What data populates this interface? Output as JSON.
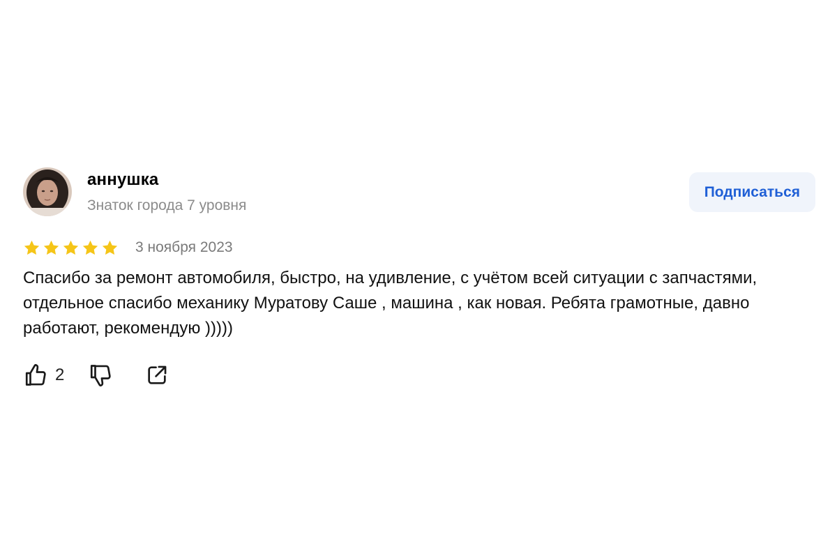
{
  "author": {
    "name": "аннушка",
    "level": "Знаток города 7 уровня",
    "avatar_icon": "user-photo"
  },
  "subscribe_label": "Подписаться",
  "rating": {
    "stars": 5,
    "max": 5,
    "color": "#f5c518"
  },
  "date": "3 ноября 2023",
  "text": "Спасибо за ремонт автомобиля, быстро, на удивление, с учётом всей ситуации с запчастями, отдельное спасибо механику Муратову Саше , машина , как новая. Ребята грамотные, давно работают, рекомендую )))))",
  "actions": {
    "like_icon": "thumbs-up-icon",
    "like_count": "2",
    "dislike_icon": "thumbs-down-icon",
    "share_icon": "share-icon"
  },
  "colors": {
    "accent": "#1f5fd6",
    "button_bg": "#f0f4fb",
    "muted": "#8b8b8b"
  }
}
